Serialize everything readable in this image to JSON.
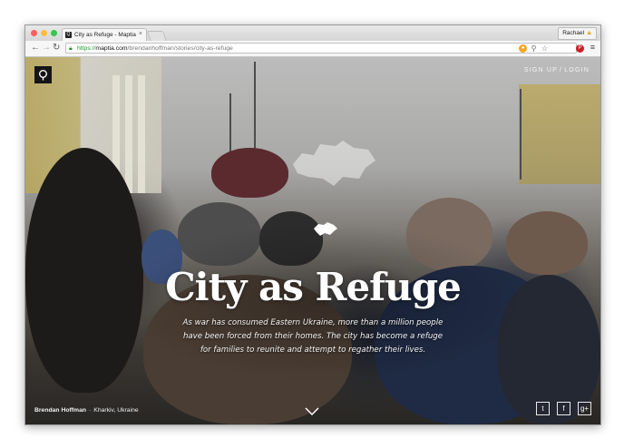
{
  "browser": {
    "tab_title": "City as Refuge - Maptia",
    "tab_favicon": "Q",
    "tab_close": "×",
    "profile_name": "Rachael",
    "url_scheme": "https://",
    "url_host": "maptia.com",
    "url_path": "/brendanhoffman/stories/city-as-refuge",
    "icons": [
      "back-icon",
      "forward-icon",
      "reload-icon",
      "lock-icon",
      "extension-icon",
      "search-icon",
      "star-icon",
      "pinterest-icon",
      "menu-icon"
    ]
  },
  "page": {
    "nav": {
      "signup": "SIGN UP",
      "separator": "/",
      "login": "LOGIN"
    },
    "title": "City as Refuge",
    "subtitle": "As war has consumed Eastern Ukraine, more than a million people have been forced from their homes. The city has become a refuge for families to reunite and attempt to regather their lives.",
    "byline": {
      "author": "Brendan Hoffman",
      "separator": "·",
      "location": "Kharkiv, Ukraine"
    },
    "social": [
      {
        "name": "twitter",
        "glyph": "t"
      },
      {
        "name": "facebook",
        "glyph": "f"
      },
      {
        "name": "google-plus",
        "glyph": "g+"
      }
    ]
  },
  "colors": {
    "https_green": "#1a9b2a",
    "pinterest_red": "#cb2027",
    "logo_bg": "#151515"
  }
}
